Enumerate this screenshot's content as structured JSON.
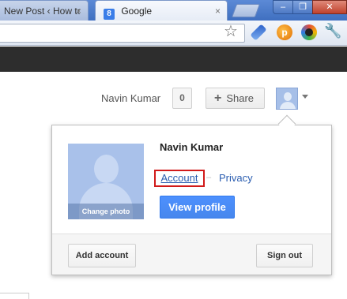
{
  "browser": {
    "tabs": [
      {
        "label": "New Post ‹ How to",
        "close": "×"
      },
      {
        "label": "Google",
        "favicon": "8",
        "close": "×"
      }
    ],
    "toolbar_icons": [
      "star-icon",
      "brush-extension-icon",
      "p-extension-icon",
      "color-ring-extension-icon",
      "wrench-icon"
    ]
  },
  "header": {
    "user_name": "Navin Kumar",
    "notification_count": "0",
    "share_label": "Share"
  },
  "card": {
    "name": "Navin Kumar",
    "change_photo": "Change photo",
    "account_link": "Account",
    "separator": "–",
    "privacy_link": "Privacy",
    "view_profile": "View profile",
    "add_account": "Add account",
    "sign_out": "Sign out"
  },
  "colors": {
    "accent_blue": "#4d90fe",
    "highlight_red": "#d11a1a",
    "link_blue": "#2a5db0",
    "gbar": "#2d2d2d"
  }
}
